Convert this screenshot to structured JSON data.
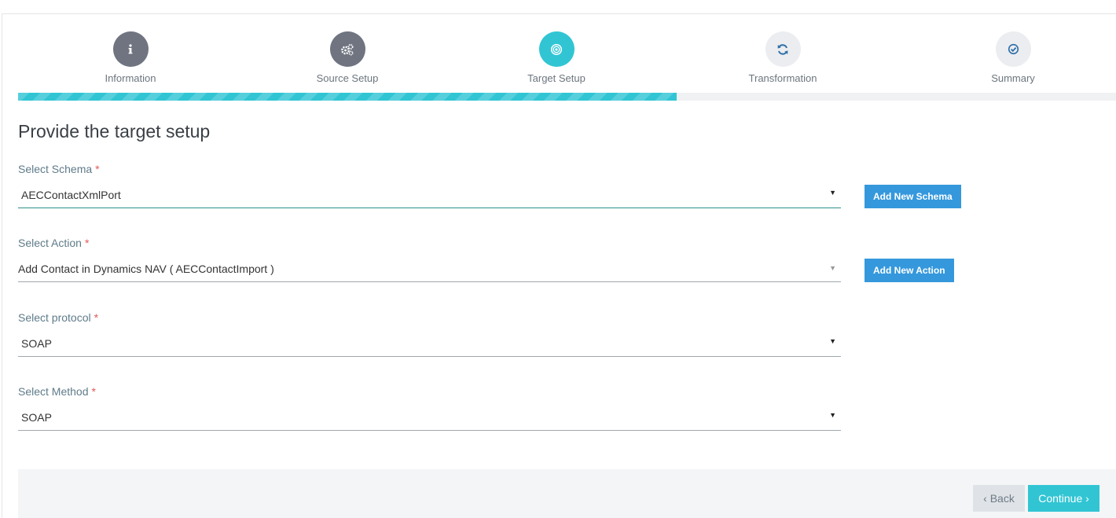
{
  "wizard": {
    "steps": [
      {
        "label": "Information",
        "icon": "info-icon",
        "state": "done"
      },
      {
        "label": "Source Setup",
        "icon": "gears-icon",
        "state": "done"
      },
      {
        "label": "Target Setup",
        "icon": "target-icon",
        "state": "active"
      },
      {
        "label": "Transformation",
        "icon": "refresh-icon",
        "state": "todo"
      },
      {
        "label": "Summary",
        "icon": "check-circle-icon",
        "state": "todo"
      }
    ],
    "progress_fraction": 0.6
  },
  "form": {
    "title": "Provide the target setup",
    "schema": {
      "label": "Select Schema",
      "required": "*",
      "value": "AECContactXmlPort",
      "add_label": "Add New Schema"
    },
    "action": {
      "label": "Select Action",
      "required": "*",
      "value": "Add Contact in Dynamics NAV ( AECContactImport )",
      "add_label": "Add New Action"
    },
    "protocol": {
      "label": "Select protocol",
      "required": "*",
      "value": "SOAP"
    },
    "method": {
      "label": "Select Method",
      "required": "*",
      "value": "SOAP"
    }
  },
  "footer": {
    "back_label": "‹ Back",
    "continue_label": "Continue ›"
  },
  "colors": {
    "accent": "#31c5d4",
    "button_blue": "#3598dc",
    "step_done": "#6f7480",
    "step_todo": "#ebedf0",
    "required": "#e05a5a"
  }
}
